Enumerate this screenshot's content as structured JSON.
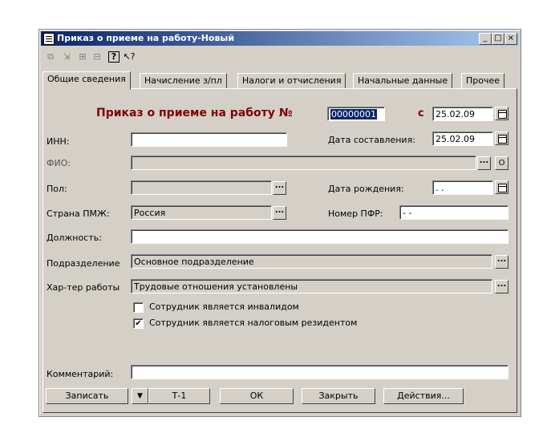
{
  "window": {
    "title": "Приказ о приеме на работу-Новый",
    "min": "_",
    "max": "□",
    "close": "×"
  },
  "toolbar": {
    "tool1": "⧉",
    "tool2": "⇲",
    "tool3": "⊞",
    "tool4": "⊟",
    "help": "?",
    "whatsthis": "↖?"
  },
  "tabs": [
    "Общие сведения",
    "Начисление з/пл",
    "Налоги и отчисления",
    "Начальные данные",
    "Прочее"
  ],
  "form": {
    "heading": "Приказ о приеме на работу №",
    "number": "00000001",
    "from_label": "с",
    "from_date": "25.02.09",
    "inn_label": "ИНН:",
    "inn_value": "",
    "date_compiled_label": "Дата составления:",
    "date_compiled": "25.02.09",
    "fio_label": "ФИО:",
    "fio_value": "",
    "o_btn": "О",
    "gender_label": "Пол:",
    "gender_value": "",
    "birth_label": "Дата рождения:",
    "birth_value": " .  .",
    "country_label": "Страна ПМЖ:",
    "country_value": "Россия",
    "pfr_label": "Номер ПФР:",
    "pfr_value": " -  -",
    "position_label": "Должность:",
    "position_value": "",
    "dept_label": "Подразделение",
    "dept_value": "Основное подразделение",
    "work_label": "Хар-тер работы",
    "work_value": "Трудовые отношения установлены",
    "disabled_label": "Сотрудник является инвалидом",
    "disabled_checked": "",
    "resident_label": "Сотрудник является налоговым резидентом",
    "resident_checked": "✔",
    "comment_label": "Комментарий:",
    "comment_value": "",
    "dots": "..."
  },
  "buttons": {
    "save": "Записать",
    "dropdown": "▼",
    "t1": "Т-1",
    "ok": "ОК",
    "close": "Закрыть",
    "actions": "Действия..."
  }
}
